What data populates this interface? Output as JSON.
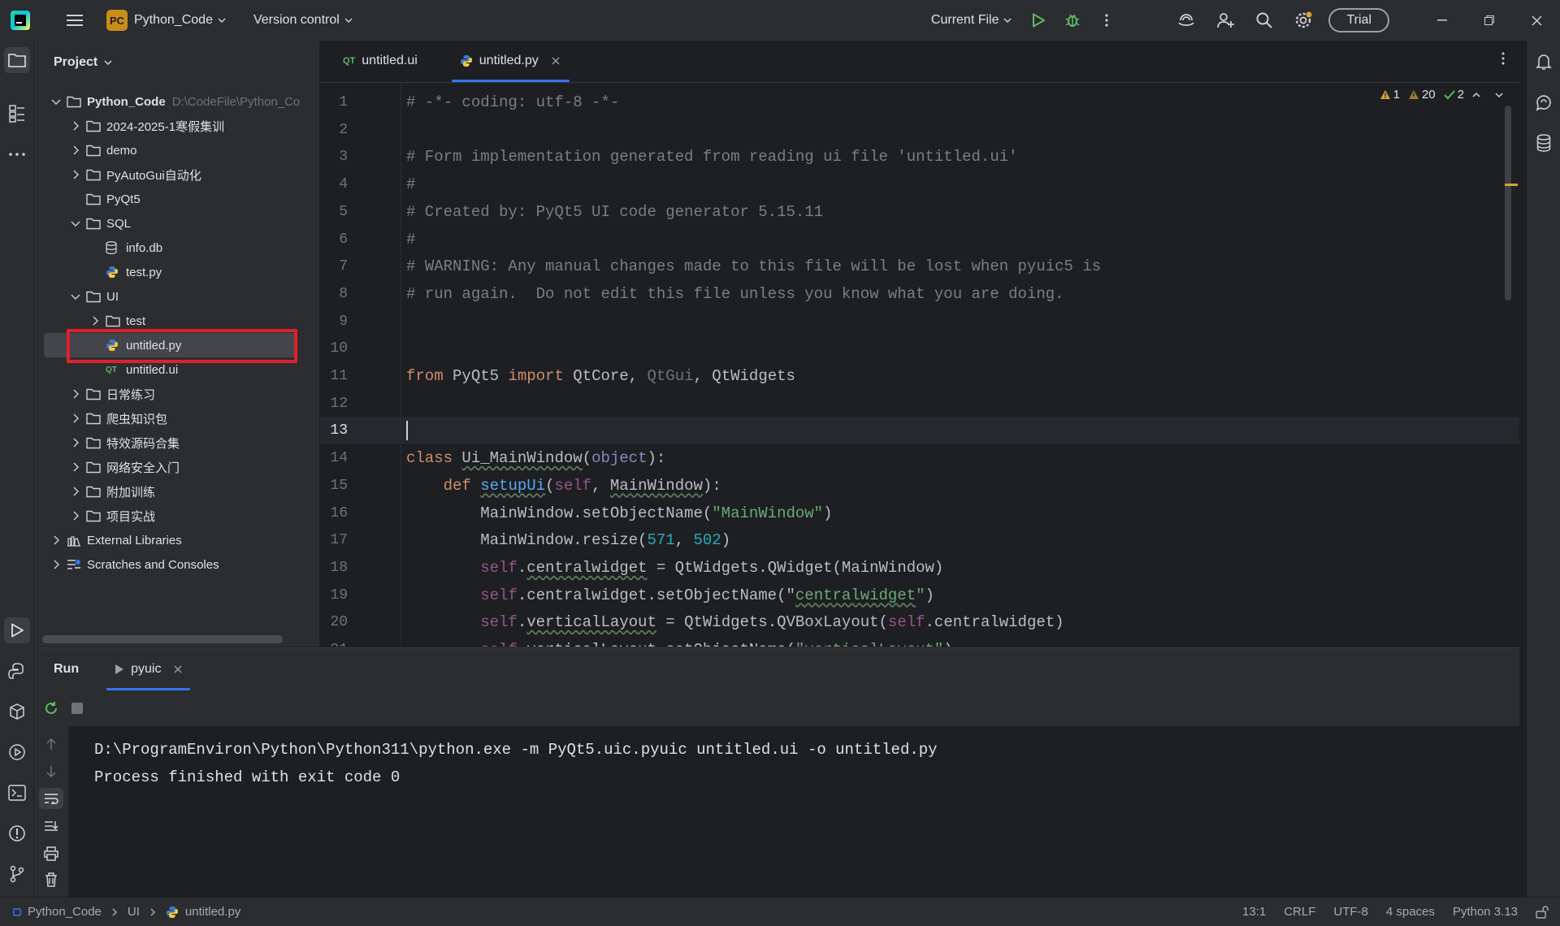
{
  "titlebar": {
    "project_badge": "PC",
    "project_name": "Python_Code",
    "vcs": "Version control",
    "run_config": "Current File",
    "trial": "Trial"
  },
  "project_panel": {
    "title": "Project",
    "tree": [
      {
        "label": "Python_Code",
        "path": "D:\\CodeFile\\Python_Co",
        "depth": 0,
        "type": "folder",
        "expanded": true,
        "bold": true
      },
      {
        "label": "2024-2025-1寒假集训",
        "depth": 1,
        "type": "folder",
        "expanded": false
      },
      {
        "label": "demo",
        "depth": 1,
        "type": "folder",
        "expanded": false
      },
      {
        "label": "PyAutoGui自动化",
        "depth": 1,
        "type": "folder",
        "expanded": false
      },
      {
        "label": "PyQt5",
        "depth": 1,
        "type": "folder",
        "expanded": null
      },
      {
        "label": "SQL",
        "depth": 1,
        "type": "folder",
        "expanded": true
      },
      {
        "label": "info.db",
        "depth": 2,
        "type": "db"
      },
      {
        "label": "test.py",
        "depth": 2,
        "type": "py"
      },
      {
        "label": "UI",
        "depth": 1,
        "type": "folder",
        "expanded": true
      },
      {
        "label": "test",
        "depth": 2,
        "type": "folder",
        "expanded": false
      },
      {
        "label": "untitled.py",
        "depth": 2,
        "type": "py",
        "selected": true
      },
      {
        "label": "untitled.ui",
        "depth": 2,
        "type": "ui"
      },
      {
        "label": "日常练习",
        "depth": 1,
        "type": "folder",
        "expanded": false
      },
      {
        "label": "爬虫知识包",
        "depth": 1,
        "type": "folder",
        "expanded": false
      },
      {
        "label": "特效源码合集",
        "depth": 1,
        "type": "folder",
        "expanded": false
      },
      {
        "label": "网络安全入门",
        "depth": 1,
        "type": "folder",
        "expanded": false
      },
      {
        "label": "附加训练",
        "depth": 1,
        "type": "folder",
        "expanded": false
      },
      {
        "label": "项目实战",
        "depth": 1,
        "type": "folder",
        "expanded": false
      },
      {
        "label": "External Libraries",
        "depth": 0,
        "type": "lib",
        "expanded": false
      },
      {
        "label": "Scratches and Consoles",
        "depth": 0,
        "type": "scratch",
        "expanded": false
      }
    ]
  },
  "editor": {
    "tabs": [
      {
        "label": "untitled.ui",
        "type": "ui",
        "active": false
      },
      {
        "label": "untitled.py",
        "type": "py",
        "active": true
      }
    ],
    "inspections": {
      "errors": "1",
      "warnings": "20",
      "ok": "2"
    },
    "current_line": 13,
    "lines": [
      [
        [
          "# -*- coding: utf-8 -*-",
          "cmt"
        ]
      ],
      [],
      [
        [
          "# Form implementation generated from reading ui file 'untitled.ui'",
          "cmt"
        ]
      ],
      [
        [
          "#",
          "cmt"
        ]
      ],
      [
        [
          "# Created by: PyQt5 UI code generator 5.15.11",
          "cmt"
        ]
      ],
      [
        [
          "#",
          "cmt"
        ]
      ],
      [
        [
          "# WARNING: Any manual changes made to this file will be lost when pyuic5 is",
          "cmt"
        ]
      ],
      [
        [
          "# run again.  Do not edit this file unless you know what you are doing.",
          "cmt"
        ]
      ],
      [],
      [],
      [
        [
          "from",
          "kw"
        ],
        [
          " PyQt5 ",
          ""
        ],
        [
          "import",
          "kw"
        ],
        [
          " QtCore, ",
          ""
        ],
        [
          "QtGui",
          "dim"
        ],
        [
          ", QtWidgets",
          ""
        ]
      ],
      [],
      [
        [
          "",
          "caret"
        ]
      ],
      [
        [
          "class",
          "kw"
        ],
        [
          " ",
          ""
        ],
        [
          "Ui_MainWindow",
          "wavy"
        ],
        [
          "(",
          ""
        ],
        [
          "object",
          "bi"
        ],
        [
          "):",
          ""
        ]
      ],
      [
        [
          "    ",
          ""
        ],
        [
          "def",
          "kw"
        ],
        [
          " ",
          ""
        ],
        [
          "setupUi",
          "fn wavy"
        ],
        [
          "(",
          ""
        ],
        [
          "self",
          "slf"
        ],
        [
          ", ",
          ""
        ],
        [
          "MainWindow",
          "wavy"
        ],
        [
          "):",
          ""
        ]
      ],
      [
        [
          "        MainWindow.setObjectName(",
          ""
        ],
        [
          "\"MainWindow\"",
          "str"
        ],
        [
          ")",
          ""
        ]
      ],
      [
        [
          "        MainWindow.resize(",
          ""
        ],
        [
          "571",
          "num"
        ],
        [
          ", ",
          ""
        ],
        [
          "502",
          "num"
        ],
        [
          ")",
          ""
        ]
      ],
      [
        [
          "        ",
          ""
        ],
        [
          "self",
          "slf"
        ],
        [
          ".",
          ""
        ],
        [
          "centralwidget",
          "wavy"
        ],
        [
          " = QtWidgets.QWidget(MainWindow)",
          ""
        ]
      ],
      [
        [
          "        ",
          ""
        ],
        [
          "self",
          "slf"
        ],
        [
          ".centralwidget.setObjectName(",
          ""
        ],
        [
          "\"",
          ""
        ],
        [
          "centralwidget",
          "str wavy"
        ],
        [
          "\"",
          "str"
        ],
        [
          ")",
          ""
        ]
      ],
      [
        [
          "        ",
          ""
        ],
        [
          "self",
          "slf"
        ],
        [
          ".",
          ""
        ],
        [
          "verticalLayout",
          "wavy"
        ],
        [
          " = QtWidgets.QVBoxLayout(",
          ""
        ],
        [
          "self",
          "slf"
        ],
        [
          ".centralwidget)",
          ""
        ]
      ],
      [
        [
          "        ",
          ""
        ],
        [
          "self",
          "slf"
        ],
        [
          ".verticalLayout.setObjectName(",
          ""
        ],
        [
          "\"verticalLayout\"",
          "str"
        ],
        [
          ")",
          ""
        ]
      ]
    ]
  },
  "run_panel": {
    "title": "Run",
    "tab": "pyuic",
    "output": [
      "D:\\ProgramEnviron\\Python\\Python311\\python.exe -m PyQt5.uic.pyuic untitled.ui -o untitled.py",
      "Process finished with exit code 0"
    ]
  },
  "statusbar": {
    "crumbs": [
      "Python_Code",
      "UI",
      "untitled.py"
    ],
    "position": "13:1",
    "line_sep": "CRLF",
    "encoding": "UTF-8",
    "indent": "4 spaces",
    "interpreter": "Python 3.13"
  },
  "colors": {
    "accent": "#3574f0",
    "highlight_box": "#e0202e",
    "bg": "#1e1f22",
    "panel": "#2b2d30"
  }
}
